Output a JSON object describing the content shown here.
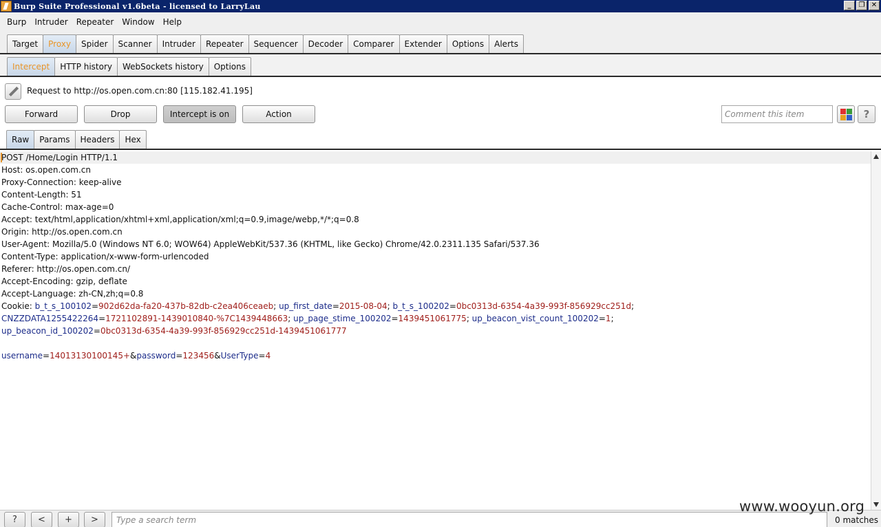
{
  "window": {
    "title": "Burp Suite Professional v1.6beta - licensed to LarryLau",
    "minimize": "_",
    "restore": "❐",
    "close": "✕"
  },
  "menu": [
    "Burp",
    "Intruder",
    "Repeater",
    "Window",
    "Help"
  ],
  "main_tabs": [
    "Target",
    "Proxy",
    "Spider",
    "Scanner",
    "Intruder",
    "Repeater",
    "Sequencer",
    "Decoder",
    "Comparer",
    "Extender",
    "Options",
    "Alerts"
  ],
  "main_tabs_active": "Proxy",
  "proxy_tabs": [
    "Intercept",
    "HTTP history",
    "WebSockets history",
    "Options"
  ],
  "proxy_tabs_active": "Intercept",
  "request_info": "Request to http://os.open.com.cn:80  [115.182.41.195]",
  "buttons": {
    "forward": "Forward",
    "drop": "Drop",
    "intercept": "Intercept is on",
    "action": "Action"
  },
  "comment_placeholder": "Comment this item",
  "help_label": "?",
  "view_tabs": [
    "Raw",
    "Params",
    "Headers",
    "Hex"
  ],
  "view_tabs_active": "Raw",
  "request": {
    "request_line": "POST /Home/Login HTTP/1.1",
    "headers": [
      "Host: os.open.com.cn",
      "Proxy-Connection: keep-alive",
      "Content-Length: 51",
      "Cache-Control: max-age=0",
      "Accept: text/html,application/xhtml+xml,application/xml;q=0.9,image/webp,*/*;q=0.8",
      "Origin: http://os.open.com.cn",
      "User-Agent: Mozilla/5.0 (Windows NT 6.0; WOW64) AppleWebKit/537.36 (KHTML, like Gecko) Chrome/42.0.2311.135 Safari/537.36",
      "Content-Type: application/x-www-form-urlencoded",
      "Referer: http://os.open.com.cn/",
      "Accept-Encoding: gzip, deflate",
      "Accept-Language: zh-CN,zh;q=0.8"
    ],
    "cookie_label": "Cookie: ",
    "cookie_lines": [
      [
        [
          "b_t_s_100102",
          "902d62da-fa20-437b-82db-c2ea406ceaeb"
        ],
        [
          "up_first_date",
          "2015-08-04"
        ],
        [
          "b_t_s_100202",
          "0bc0313d-6354-4a39-993f-856929cc251d"
        ]
      ],
      [
        [
          "CNZZDATA1255422264",
          "1721102891-1439010840-%7C1439448663"
        ],
        [
          "up_page_stime_100202",
          "1439451061775"
        ],
        [
          "up_beacon_vist_count_100202",
          "1"
        ]
      ],
      [
        [
          "up_beacon_id_100202",
          "0bc0313d-6354-4a39-993f-856929cc251d-1439451061777"
        ]
      ]
    ],
    "body": [
      [
        "username",
        "14013130100145+"
      ],
      [
        "password",
        "123456"
      ],
      [
        "UserType",
        "4"
      ]
    ]
  },
  "bottom": {
    "help": "?",
    "prev": "<",
    "add": "+",
    "next": ">",
    "search_placeholder": "Type a search term",
    "matches": "0 matches"
  },
  "watermark": "www.wooyun.org",
  "colors": {
    "title_bar": "#0a246a",
    "active_tab_text": "#e8952a",
    "param_name": "#1c2c8a",
    "param_value": "#a0201c"
  }
}
